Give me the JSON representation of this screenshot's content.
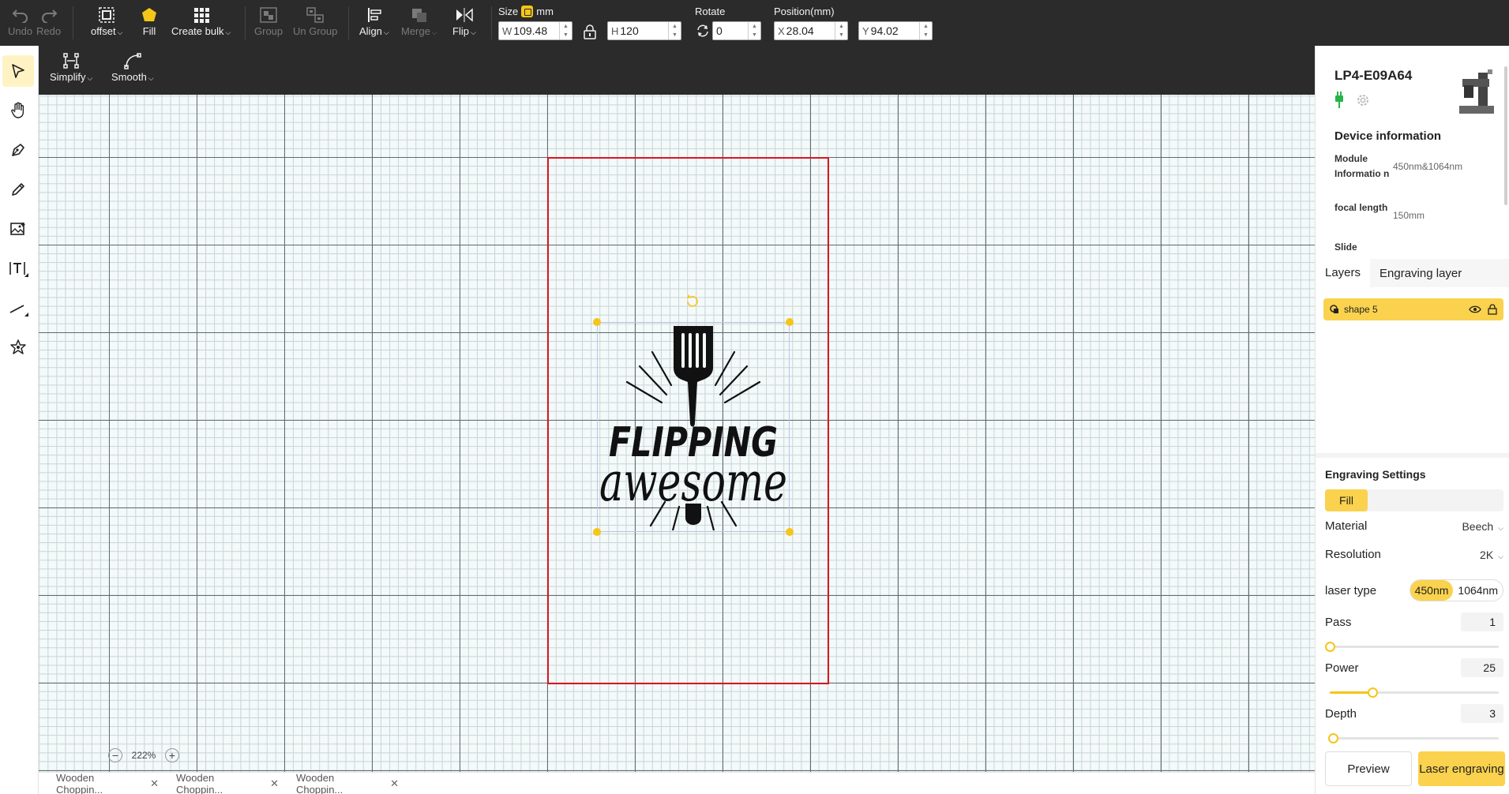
{
  "toolbar": {
    "undo": "Undo",
    "redo": "Redo",
    "offset": "offset",
    "fill": "Fill",
    "create_bulk": "Create bulk",
    "group": "Group",
    "ungroup": "Un Group",
    "align": "Align",
    "merge": "Merge",
    "flip": "Flip",
    "size_label": "Size",
    "size_unit": "mm",
    "width_prefix": "W",
    "width": "109.48",
    "height_prefix": "H",
    "height": "120",
    "rotate_label": "Rotate",
    "rotate": "0",
    "position_label": "Position(mm)",
    "x_prefix": "X",
    "x": "28.04",
    "y_prefix": "Y",
    "y": "94.02"
  },
  "subbar": {
    "simplify": "Simplify",
    "smooth": "Smooth"
  },
  "left_tools": [
    "select-icon",
    "hand-icon",
    "pen-icon",
    "pencil-icon",
    "image-icon",
    "text-icon",
    "line-icon",
    "shape-star-icon"
  ],
  "canvas": {
    "zoom": "222%",
    "artwork_line1": "FLIPPING",
    "artwork_line2": "awesome"
  },
  "file_tabs": [
    "Wooden Choppin...",
    "Wooden Choppin...",
    "Wooden Choppin..."
  ],
  "device": {
    "name": "LP4-E09A64",
    "info_title": "Device information",
    "rows": [
      {
        "key": "Module Informatio n",
        "value": "450nm&1064nm"
      },
      {
        "key": "focal length",
        "value": "150mm"
      },
      {
        "key": "Slide",
        "value": ""
      }
    ]
  },
  "layers": {
    "tab_layers": "Layers",
    "tab_engraving": "Engraving layer",
    "items": [
      {
        "name": "shape 5"
      }
    ]
  },
  "engraving": {
    "title": "Engraving Settings",
    "mode": "Fill",
    "material_label": "Material",
    "material": "Beech",
    "resolution_label": "Resolution",
    "resolution": "2K",
    "laser_type_label": "laser type",
    "laser_a": "450nm",
    "laser_b": "1064nm",
    "pass_label": "Pass",
    "pass": "1",
    "power_label": "Power",
    "power": "25",
    "depth_label": "Depth",
    "depth": "3",
    "preview": "Preview",
    "laser_engraving": "Laser engraving"
  },
  "colors": {
    "accent": "#f5c518",
    "toolbar_bg": "#2b2b2b",
    "workarea_border": "#d9171e"
  }
}
